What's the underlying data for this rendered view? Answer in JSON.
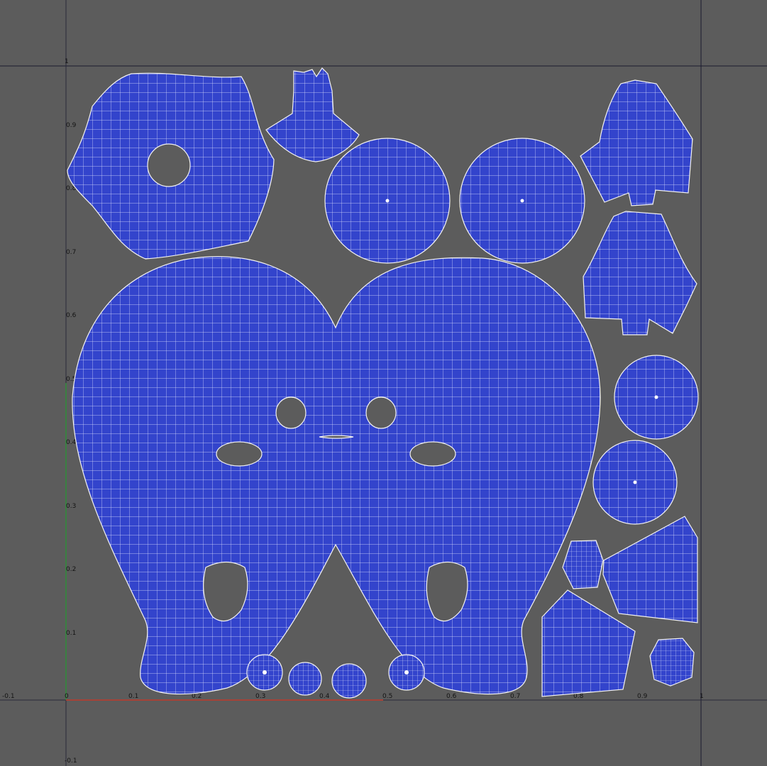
{
  "viewport": {
    "background_color": "#5c5c5c",
    "shell_color": "#3344cc",
    "wire_color": "#ffffff",
    "u_axis_color": "#c0392b",
    "v_axis_color": "#2e8b3a",
    "boundary_color": "#1a1a2e"
  },
  "ticks": {
    "u": [
      "-0.1",
      "0",
      "0.1",
      "0.2",
      "0.3",
      "0.4",
      "0.5",
      "0.6",
      "0.7",
      "0.8",
      "0.9",
      "1"
    ],
    "v": [
      "1",
      "0.9",
      "0.8",
      "0.7",
      "0.6",
      "0.5",
      "0.4",
      "0.3",
      "0.2",
      "0.1",
      "-0.1"
    ]
  },
  "uv_shells": [
    "face-shell",
    "hood-shell",
    "collar-shell",
    "disc-large-a",
    "disc-large-b",
    "bag-shell-a",
    "bag-shell-b",
    "disc-medium-a",
    "disc-medium-b",
    "patch-small",
    "curved-panel-a",
    "curved-panel-b",
    "patch-round",
    "button-a",
    "button-b",
    "button-c",
    "button-d"
  ]
}
